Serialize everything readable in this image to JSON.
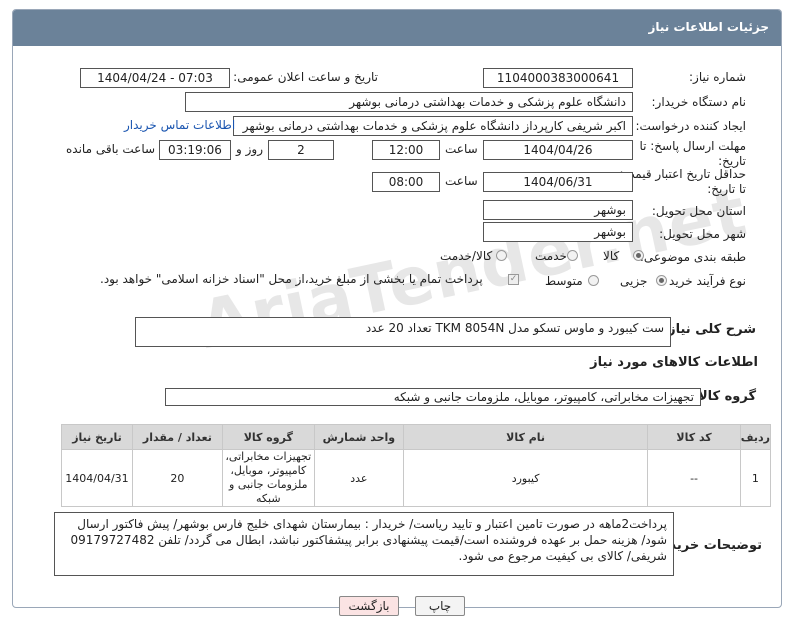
{
  "header": {
    "title": "جزئیات اطلاعات نیاز"
  },
  "need": {
    "number_label": "شماره نیاز:",
    "number": "1104000383000641",
    "announce_label": "تاریخ و ساعت اعلان عمومی:",
    "announce_value": "1404/04/24 - 07:03",
    "buyer_org_label": "نام دستگاه خریدار:",
    "buyer_org": "دانشگاه علوم پزشکی و خدمات بهداشتی درمانی بوشهر",
    "creator_label": "ایجاد کننده درخواست:",
    "creator": "اکبر شریفی کارپرداز دانشگاه علوم پزشکی و خدمات بهداشتی درمانی بوشهر",
    "contact_link": "اطلاعات تماس خریدار",
    "deadline_label_1": "مهلت ارسال پاسخ: تا",
    "deadline_label_2": "تاریخ:",
    "deadline_date": "1404/04/26",
    "time_label": "ساعت",
    "deadline_time": "12:00",
    "days_value": "2",
    "days_label": "روز و",
    "remaining_value": "03:19:06",
    "remaining_label": "ساعت باقی مانده",
    "price_validity_label_1": "حداقل تاریخ اعتبار قیمت:",
    "price_validity_label_2": "تا تاریخ:",
    "price_validity_date": "1404/06/31",
    "price_validity_time": "08:00",
    "province_label": "استان محل تحویل:",
    "province": "بوشهر",
    "city_label": "شهر محل تحویل:",
    "city": "بوشهر",
    "category_label": "طبقه بندی موضوعی:",
    "category_options": [
      "کالا",
      "خدمت",
      "کالا/خدمت"
    ],
    "category_selected": "کالا",
    "process_label": "نوع فرآیند خرید :",
    "process_options": [
      "جزیی",
      "متوسط"
    ],
    "process_selected": "جزیی",
    "payment_note": "پرداخت تمام یا بخشی از مبلغ خرید،از محل \"اسناد خزانه اسلامی\" خواهد بود."
  },
  "description": {
    "label": "شرح کلی نیاز:",
    "value": "ست کیبورد و ماوس تسکو مدل TKM 8054N تعداد 20 عدد"
  },
  "goods": {
    "section_title": "اطلاعات کالاهای مورد نیاز",
    "group_label": "گروه کالا:",
    "group_value": "تجهیزات مخابراتی، کامپیوتر، موبایل، ملزومات جانبی و شبکه",
    "columns": [
      "ردیف",
      "کد کالا",
      "نام کالا",
      "واحد شمارش",
      "گروه کالا",
      "تعداد / مقدار",
      "تاریخ نیاز"
    ],
    "rows": [
      {
        "row": "1",
        "code": "--",
        "name": "کیبورد",
        "unit": "عدد",
        "group": "تجهیزات مخابراتی، کامپیوتر، موبایل، ملزومات جانبی و شبکه",
        "qty": "20",
        "date": "1404/04/31"
      }
    ]
  },
  "buyer_notes": {
    "label": "توضیحات خریدار:",
    "value": "پرداخت2ماهه در صورت تامین اعتبار و تایید ریاست/ خریدار : بیمارستان شهدای خلیج فارس بوشهر/ پیش فاکتور ارسال شود/ هزینه حمل بر عهده فروشنده است/قیمت پیشنهادی برابر پیشفاکتور نباشد، ابطال می گردد/ تلفن 09179727482 شریفی/ کالای بی کیفیت مرجوع می شود."
  },
  "buttons": {
    "print": "چاپ",
    "back": "بازگشت"
  },
  "watermark": "AriaTender.net",
  "colors": {
    "header_bg": "#6b8299",
    "link": "#1a55b0",
    "back_btn_bg": "#fbe3e3"
  }
}
